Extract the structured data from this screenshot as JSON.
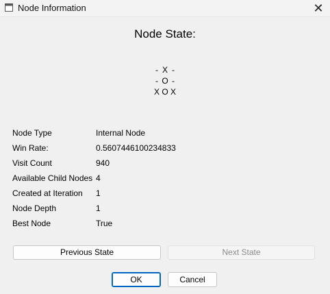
{
  "window": {
    "title": "Node Information",
    "app_icon": "window-icon",
    "close_icon": "close-icon",
    "close_glyph": "✕"
  },
  "heading": "Node State:",
  "board": [
    [
      "-",
      "X",
      "-"
    ],
    [
      "-",
      "O",
      "-"
    ],
    [
      "X",
      "O",
      "X"
    ]
  ],
  "info": [
    {
      "label": "Node Type",
      "value": "Internal Node"
    },
    {
      "label": "Win Rate:",
      "value": "0.5607446100234833"
    },
    {
      "label": "Visit Count",
      "value": "940"
    },
    {
      "label": "Available Child Nodes",
      "value": "4"
    },
    {
      "label": "Created at Iteration",
      "value": "1"
    },
    {
      "label": "Node Depth",
      "value": "1"
    },
    {
      "label": "Best Node",
      "value": "True"
    }
  ],
  "buttons": {
    "previous": "Previous State",
    "next": "Next State",
    "ok": "OK",
    "cancel": "Cancel"
  },
  "colors": {
    "accent": "#0067c0",
    "background": "#f0f0f0"
  }
}
